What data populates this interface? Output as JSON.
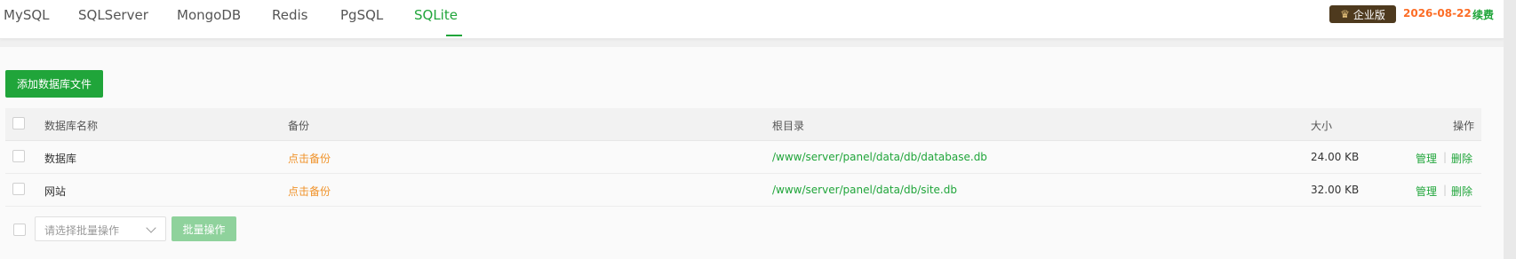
{
  "tabs": [
    {
      "label": "MySQL",
      "active": false
    },
    {
      "label": "SQLServer",
      "active": false
    },
    {
      "label": "MongoDB",
      "active": false
    },
    {
      "label": "Redis",
      "active": false
    },
    {
      "label": "PgSQL",
      "active": false
    },
    {
      "label": "SQLite",
      "active": true
    }
  ],
  "header": {
    "edition_label": "企业版",
    "expire_date": "2026-08-22",
    "renew_label": "续费",
    "crown_icon": "crown-icon"
  },
  "toolbar": {
    "add_label": "添加数据库文件"
  },
  "table": {
    "columns": {
      "name": "数据库名称",
      "backup": "备份",
      "root": "根目录",
      "size": "大小",
      "ops": "操作"
    },
    "rows": [
      {
        "name": "数据库",
        "backup": "点击备份",
        "path": "/www/server/panel/data/db/database.db",
        "size": "24.00 KB",
        "manage": "管理",
        "delete": "删除"
      },
      {
        "name": "网站",
        "backup": "点击备份",
        "path": "/www/server/panel/data/db/site.db",
        "size": "32.00 KB",
        "manage": "管理",
        "delete": "删除"
      }
    ]
  },
  "batch": {
    "select_placeholder": "请选择批量操作",
    "button_label": "批量操作"
  },
  "colors": {
    "accent": "#20a53a",
    "warning": "#f0932b",
    "expire": "#fc6d26"
  }
}
